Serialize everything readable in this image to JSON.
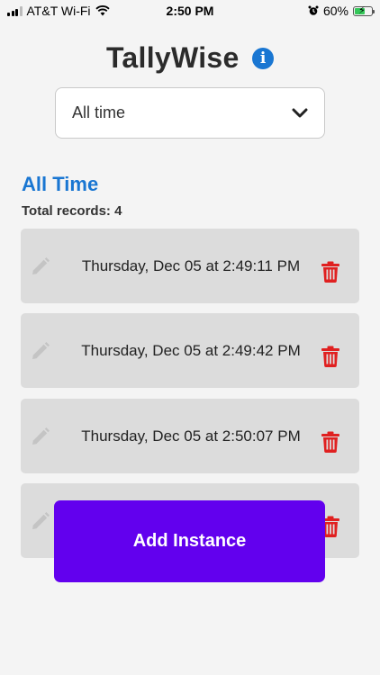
{
  "status_bar": {
    "carrier": "AT&T Wi-Fi",
    "time": "2:50 PM",
    "battery": "60%",
    "battery_level": 0.6
  },
  "header": {
    "title": "TallyWise",
    "info_icon": "info-circle-icon"
  },
  "filter": {
    "selected": "All time",
    "icon": "chevron-down-icon"
  },
  "section": {
    "title": "All Time",
    "total_label": "Total records: 4"
  },
  "records": [
    {
      "timestamp": "Thursday, Dec 05 at 2:49:11 PM"
    },
    {
      "timestamp": "Thursday, Dec 05 at 2:49:42 PM"
    },
    {
      "timestamp": "Thursday, Dec 05 at 2:50:07 PM"
    },
    {
      "timestamp": ""
    }
  ],
  "actions": {
    "add_label": "Add Instance"
  },
  "colors": {
    "accent": "#1976d2",
    "primary_button": "#6200ee",
    "delete": "#e02020",
    "record_bg": "#dcdcdc"
  }
}
